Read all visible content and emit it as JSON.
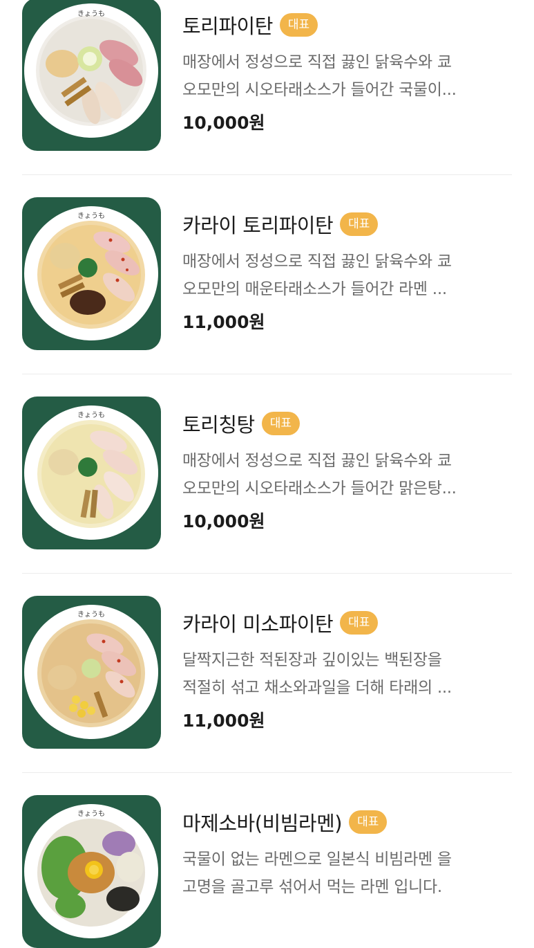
{
  "menu": {
    "items": [
      {
        "title": "토리파이탄",
        "badge": "대표",
        "desc_line1": "매장에서 정성으로 직접 끓인 닭육수와 쿄",
        "desc_line2": "오모만의 시오타래소스가 들어간 국물이...",
        "price": "10,000원"
      },
      {
        "title": "카라이 토리파이탄",
        "badge": "대표",
        "desc_line1": "매장에서 정성으로 직접 끓인 닭육수와 쿄",
        "desc_line2": "오모만의 매운타래소스가 들어간 라멘 ...",
        "price": "11,000원"
      },
      {
        "title": "토리칭탕",
        "badge": "대표",
        "desc_line1": "매장에서 정성으로 직접 끓인 닭육수와 쿄",
        "desc_line2": "오모만의 시오타래소스가 들어간 맑은탕...",
        "price": "10,000원"
      },
      {
        "title": "카라이 미소파이탄",
        "badge": "대표",
        "desc_line1": "달짝지근한 적된장과 깊이있는 백된장을",
        "desc_line2": "적절히 섞고 채소와과일을 더해 타래의 ...",
        "price": "11,000원"
      },
      {
        "title": "마제소바(비빔라멘)",
        "badge": "대표",
        "desc_line1": "국물이 없는 라멘으로 일본식 비빔라멘 을",
        "desc_line2": "고명을 골고루 섞어서 먹는 라멘 입니다.",
        "price": ""
      }
    ]
  },
  "thumbnail": {
    "bowl_text": "きょうも"
  },
  "colors": {
    "thumb_bg": "#245c45",
    "badge_bg": "#f2b54a",
    "desc_text": "#6b6b6b"
  }
}
